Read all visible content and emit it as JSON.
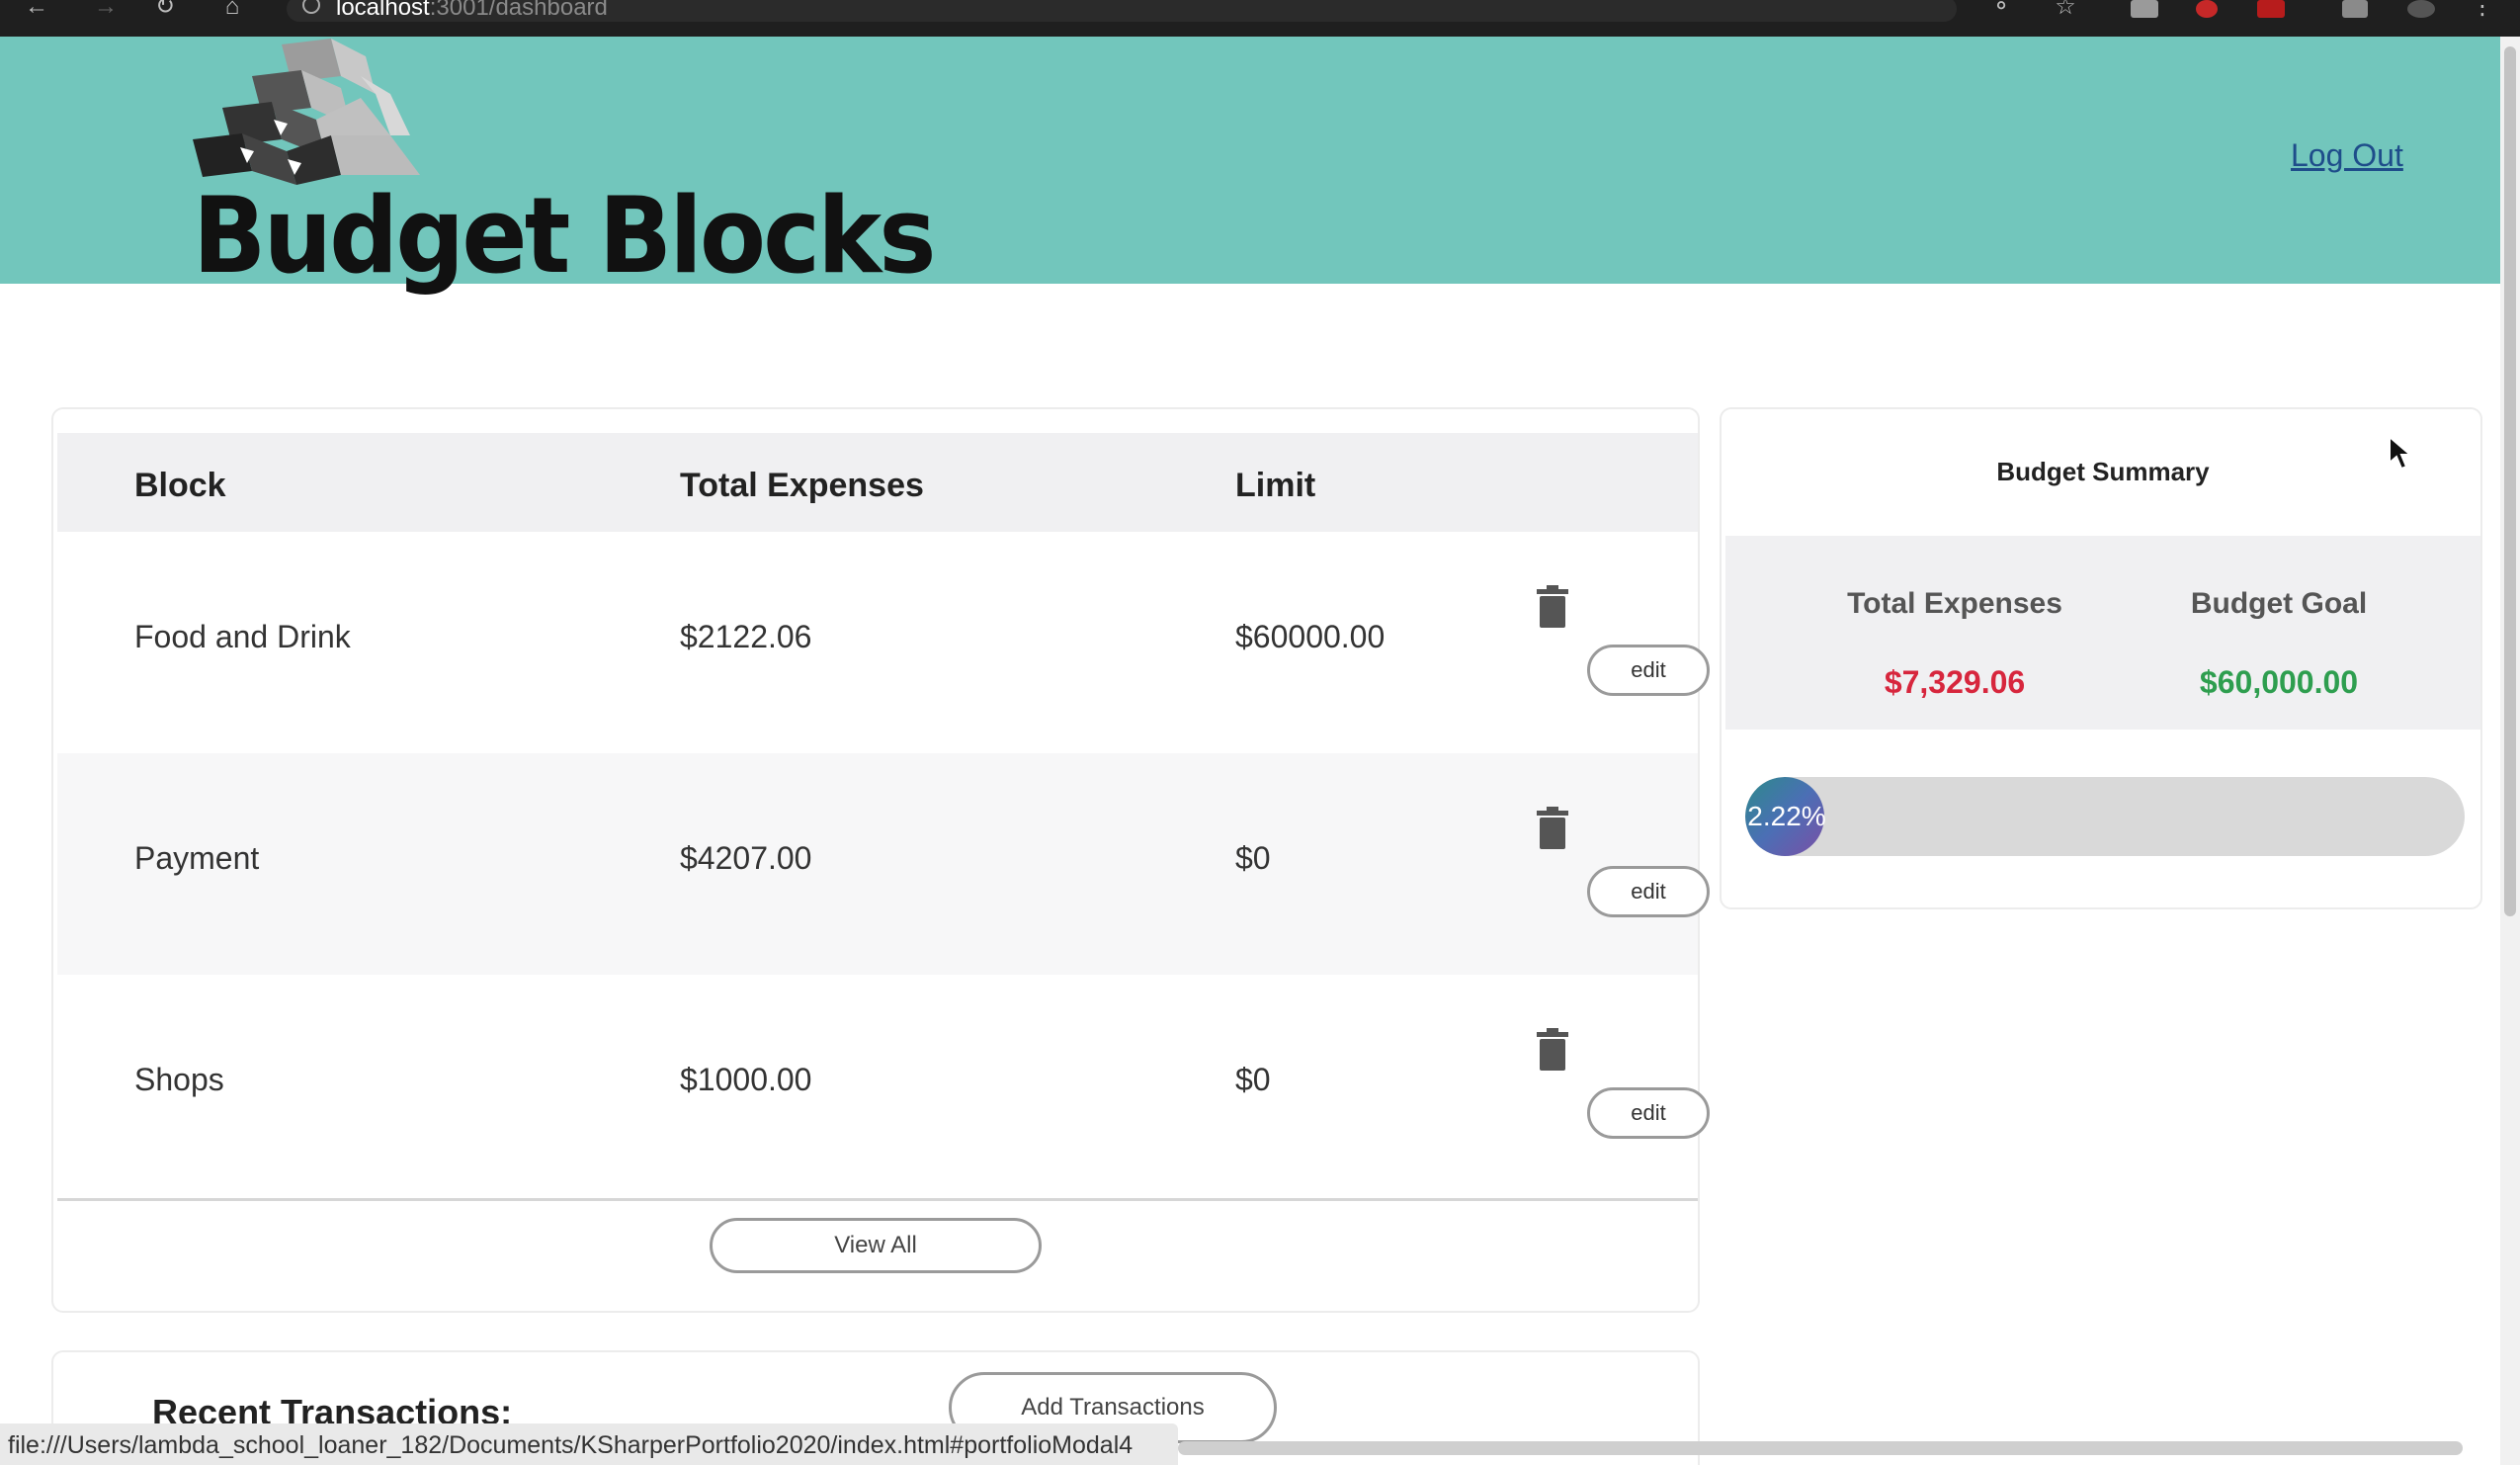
{
  "browser": {
    "url_host": "localhost",
    "url_path": ":3001/dashboard"
  },
  "header": {
    "brand": "Budget Blocks",
    "logout_label": "Log Out",
    "background": "#72c6bc"
  },
  "blocks_table": {
    "columns": [
      "Block",
      "Total Expenses",
      "Limit"
    ],
    "rows": [
      {
        "block": "Food and Drink",
        "total": "$2122.06",
        "limit": "$60000.00",
        "edit_label": "edit"
      },
      {
        "block": "Payment",
        "total": "$4207.00",
        "limit": "$0",
        "edit_label": "edit"
      },
      {
        "block": "Shops",
        "total": "$1000.00",
        "limit": "$0",
        "edit_label": "edit"
      }
    ],
    "view_all_label": "View All"
  },
  "recent": {
    "title": "Recent Transactions:",
    "add_label": "Add Transactions"
  },
  "summary": {
    "title": "Budget Summary",
    "expenses_label": "Total Expenses",
    "expenses_value": "$7,329.06",
    "expenses_color": "#d7263d",
    "goal_label": "Budget Goal",
    "goal_value": "$60,000.00",
    "goal_color": "#2e9e4f",
    "progress_label": "2.22%",
    "progress_fraction": 0.0222
  },
  "status_bar": {
    "text": "file:///Users/lambda_school_loaner_182/Documents/KSharperPortfolio2020/index.html#portfolioModal4"
  },
  "icons": [
    "back-icon",
    "forward-icon",
    "reload-icon",
    "home-icon",
    "info-icon",
    "key-icon",
    "star-icon",
    "trash-icon",
    "logo-blocks-icon",
    "cursor-icon"
  ]
}
